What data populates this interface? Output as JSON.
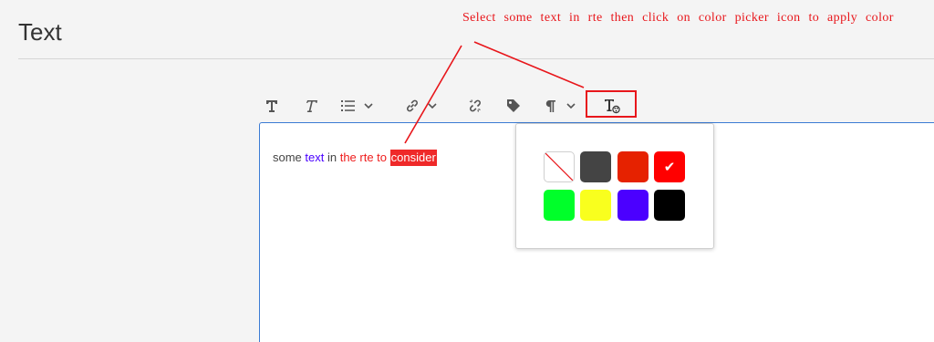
{
  "header": {
    "title": "Text"
  },
  "annotation": {
    "text": "Select some text in rte then click on color picker icon to apply color",
    "color": "#e8161b"
  },
  "toolbar": {
    "items": [
      {
        "name": "bold",
        "icon": "bold-T-icon"
      },
      {
        "name": "italic",
        "icon": "italic-T-icon"
      },
      {
        "name": "list",
        "icon": "list-icon",
        "dropdown": true
      },
      {
        "name": "link",
        "icon": "link-icon",
        "dropdown": true
      },
      {
        "name": "unlink",
        "icon": "unlink-icon"
      },
      {
        "name": "tag",
        "icon": "tag-icon"
      },
      {
        "name": "paragraph",
        "icon": "pilcrow-icon",
        "dropdown": true
      },
      {
        "name": "text-color",
        "icon": "text-color-picker-icon",
        "highlighted": true
      }
    ]
  },
  "editor": {
    "segments": [
      {
        "text": "some ",
        "color": "#444444"
      },
      {
        "text": "text",
        "color": "#4900ff"
      },
      {
        "text": " in ",
        "color": "#444444"
      },
      {
        "text": "the rte to ",
        "color": "#ef1c1c"
      },
      {
        "text": "consider",
        "color": "#ffffff",
        "selected": true,
        "highlight": "#ef2929"
      }
    ]
  },
  "palette": {
    "swatches": [
      {
        "name": "none",
        "color": "none"
      },
      {
        "name": "dark-gray",
        "color": "#444444"
      },
      {
        "name": "orange-red",
        "color": "#e62200"
      },
      {
        "name": "red",
        "color": "#ff0000",
        "checked": true,
        "check": "✔"
      },
      {
        "name": "green",
        "color": "#00ff2a"
      },
      {
        "name": "yellow",
        "color": "#f9ff1e"
      },
      {
        "name": "blue",
        "color": "#4b00ff"
      },
      {
        "name": "black",
        "color": "#000000"
      }
    ]
  }
}
